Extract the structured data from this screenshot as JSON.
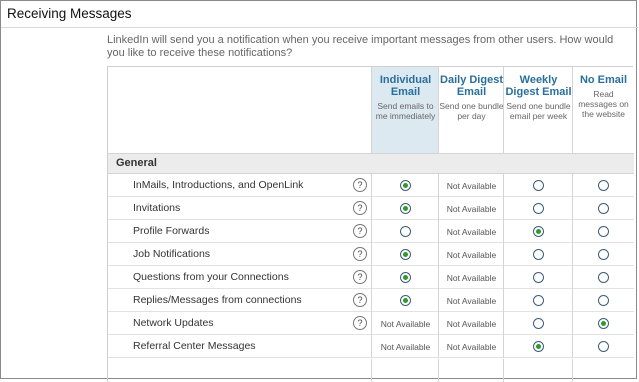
{
  "title": "Receiving Messages",
  "intro": "LinkedIn will send you a notification when you receive important messages from other users. How would you like to receive these notifications?",
  "columns": [
    {
      "header": "Individual Email",
      "desc": "Send emails to me immediately"
    },
    {
      "header": "Daily Digest Email",
      "desc": "Send one bundle per day"
    },
    {
      "header": "Weekly Digest Email",
      "desc": "Send one bundle email per week"
    },
    {
      "header": "No Email",
      "desc": "Read messages on the website"
    }
  ],
  "section": "General",
  "help_glyph": "?",
  "not_available": "Not Available",
  "rows": [
    {
      "label": "InMails, Introductions, and OpenLink",
      "help": true,
      "options": [
        "selected",
        "na",
        "empty",
        "empty"
      ]
    },
    {
      "label": "Invitations",
      "help": true,
      "options": [
        "selected",
        "na",
        "empty",
        "empty"
      ]
    },
    {
      "label": "Profile Forwards",
      "help": true,
      "options": [
        "empty",
        "na",
        "selected",
        "empty"
      ]
    },
    {
      "label": "Job Notifications",
      "help": true,
      "options": [
        "selected",
        "na",
        "empty",
        "empty"
      ]
    },
    {
      "label": "Questions from your Connections",
      "help": true,
      "options": [
        "selected",
        "na",
        "empty",
        "empty"
      ]
    },
    {
      "label": "Replies/Messages from connections",
      "help": true,
      "options": [
        "selected",
        "na",
        "empty",
        "empty"
      ]
    },
    {
      "label": "Network Updates",
      "help": true,
      "options": [
        "na",
        "na",
        "empty",
        "selected"
      ]
    },
    {
      "label": "Referral Center Messages",
      "help": false,
      "options": [
        "na",
        "na",
        "selected",
        "empty"
      ]
    }
  ],
  "colors": {
    "header_text": "#2a6f9b",
    "selected_dot": "#2e9a2a",
    "highlight_column": "#dde9f1"
  }
}
